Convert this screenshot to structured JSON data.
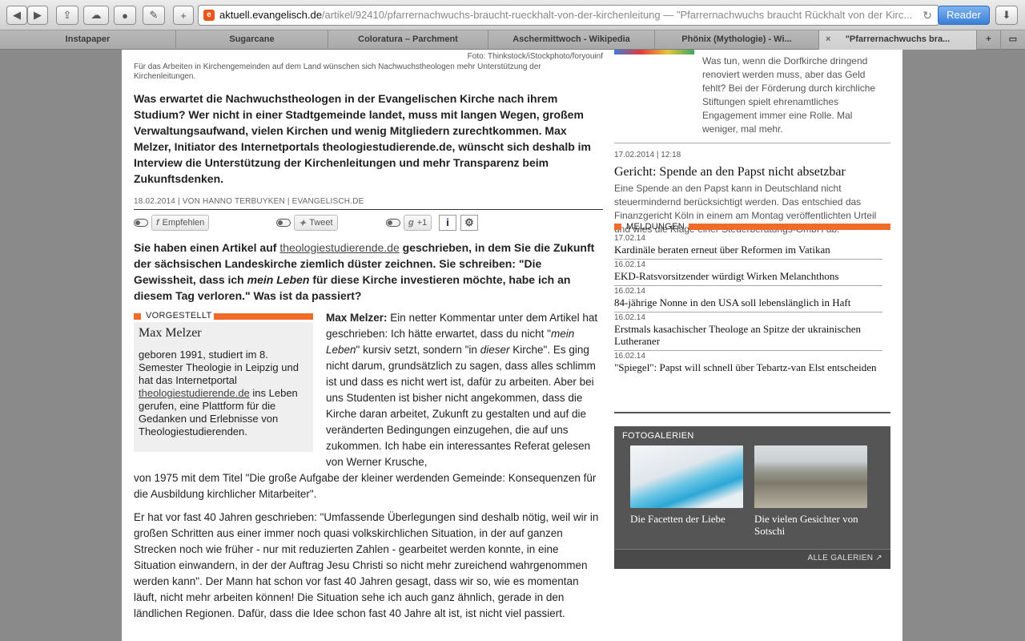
{
  "toolbar": {
    "back": "◀",
    "forward": "▶",
    "url_host": "aktuell.evangelisch.de",
    "url_path": "/artikel/92410/pfarrernachwuchs-braucht-rueckhalt-von-der-kirchenleitung — \"Pfarrernachwuchs braucht Rückhalt von der Kirc...",
    "reader": "Reader"
  },
  "tabs": [
    {
      "label": "Instapaper"
    },
    {
      "label": "Sugarcane"
    },
    {
      "label": "Coloratura – Parchment"
    },
    {
      "label": "Aschermittwoch - Wikipedia"
    },
    {
      "label": "Phönix (Mythologie) - Wi..."
    },
    {
      "label": "\"Pfarrernachwuchs bra..."
    }
  ],
  "article": {
    "photo_credit": "Foto: Thinkstock/iStockphoto/foryouinf",
    "caption": "Für das Arbeiten in Kirchengemeinden auf dem Land wünschen sich Nachwuchstheologen mehr Unterstützung der Kirchenleitungen.",
    "lead": "Was erwartet die Nachwuchstheologen in der Evangelischen Kirche nach ihrem Studium? Wer nicht in einer Stadtgemeinde landet, muss mit langen Wegen, großem Verwaltungsaufwand, vielen Kirchen und wenig Mitgliedern zurechtkommen. Max Melzer, Initiator des Internetportals theologiestudierende.de, wünscht sich deshalb im Interview die Unterstützung der Kirchenleitungen und mehr Transparenz beim Zukunftsdenken.",
    "byline": "18.02.2014 | VON HANNO TERBUYKEN | EVANGELISCH.DE",
    "share": {
      "facebook": "Empfehlen",
      "twitter": "Tweet",
      "gplus": "+1",
      "info": "i",
      "settings": "⚙"
    },
    "question_1": "Sie haben einen Artikel auf",
    "question_link": "theologiestudierende.de",
    "question_2": "geschrieben, in dem Sie die Zukunft der sächsischen Landeskirche ziemlich düster zeichnen. Sie schreiben: \"Die Gewissheit, dass ich",
    "question_em": "mein Leben",
    "question_3": "für diese Kirche investieren möchte, habe ich an diesem Tag verloren.\" Was ist da passiert?",
    "infobox": {
      "heading": "VORGESTELLT",
      "name": "Max Melzer",
      "bio_1": "geboren 1991, studiert im 8. Semester Theologie in Leipzig und hat das Internetportal",
      "bio_link": "theologiestudierende.de",
      "bio_2": "ins Leben gerufen, eine Plattform für die Gedanken und Erlebnisse von Theologiestudierenden."
    },
    "answer_speaker": "Max Melzer:",
    "answer_1": "Ein netter Kommentar unter dem Artikel hat geschrieben: Ich hätte erwartet, dass du nicht \"",
    "answer_em1": "mein Leben",
    "answer_2": "\" kursiv setzt, sondern \"in",
    "answer_em2": "dieser",
    "answer_3": "Kirche\". Es ging nicht darum, grundsätzlich zu sagen, dass alles schlimm ist und dass es nicht wert ist, dafür zu arbeiten. Aber bei uns Studenten ist bisher nicht angekommen, dass die Kirche daran arbeitet, Zukunft zu gestalten und auf die veränderten Bedingungen einzugehen, die auf uns zukommen. Ich habe ein interessantes Referat gelesen von Werner Krusche,",
    "answer_full": "von 1975 mit dem Titel \"Die große Aufgabe der kleiner werdenden Gemeinde: Konsequenzen für die Ausbildung kirchlicher Mitarbeiter\".",
    "answer_p2": "Er hat vor fast 40 Jahren geschrieben: \"Umfassende Überlegungen sind deshalb nötig, weil wir in großen Schritten aus einer immer noch quasi volkskirchlichen Situation, in der auf ganzen Strecken noch wie früher - nur mit reduzierten Zahlen - gearbeitet werden konnte, in eine Situation einwandern, in der der Auftrag Jesu Christi so nicht mehr zureichend wahrgenommen werden kann\". Der Mann hat schon vor fast 40 Jahren gesagt, dass wir so, wie es momentan läuft, nicht mehr arbeiten können! Die Situation sehe ich auch ganz ähnlich, gerade in den ländlichen Regionen. Dafür, dass die Idee schon fast 40 Jahre alt ist, ist nicht viel passiert."
  },
  "sidebar": {
    "teaser1_text": "Was tun, wenn die Dorfkirche dringend renoviert werden muss, aber das Geld fehlt? Bei der Förderung durch kirchliche Stiftungen spielt ehrenamtliches Engagement immer eine Rolle. Mal weniger, mal mehr.",
    "teaser2_date": "17.02.2014 | 12:18",
    "teaser2_title": "Gericht: Spende an den Papst nicht absetzbar",
    "teaser2_text": "Eine Spende an den Papst kann in Deutschland nicht steuermindernd berücksichtigt werden. Das entschied das Finanzgericht Köln in einem am Montag veröffentlichten Urteil und wies die Klage einer Steuerberatungs-GmbH ab.",
    "meldungen_heading": "MELDUNGEN",
    "meldungen": [
      {
        "date": "17.02.14",
        "title": "Kardinäle beraten erneut über Reformen im Vatikan"
      },
      {
        "date": "16.02.14",
        "title": "EKD-Ratsvorsitzender würdigt Wirken Melanchthons"
      },
      {
        "date": "16.02.14",
        "title": "84-jährige Nonne in den USA soll lebenslänglich in Haft"
      },
      {
        "date": "16.02.14",
        "title": "Erstmals kasachischer Theologe an Spitze der ukrainischen Lutheraner"
      },
      {
        "date": "16.02.14",
        "title": "\"Spiegel\": Papst will schnell über Tebartz-van Elst entscheiden"
      }
    ],
    "gallery": {
      "heading": "FOTOGALERIEN",
      "items": [
        {
          "caption": "Die Facetten der Liebe"
        },
        {
          "caption": "Die vielen Gesichter von Sotschi"
        }
      ],
      "all": "ALLE GALERIEN ↗"
    }
  }
}
